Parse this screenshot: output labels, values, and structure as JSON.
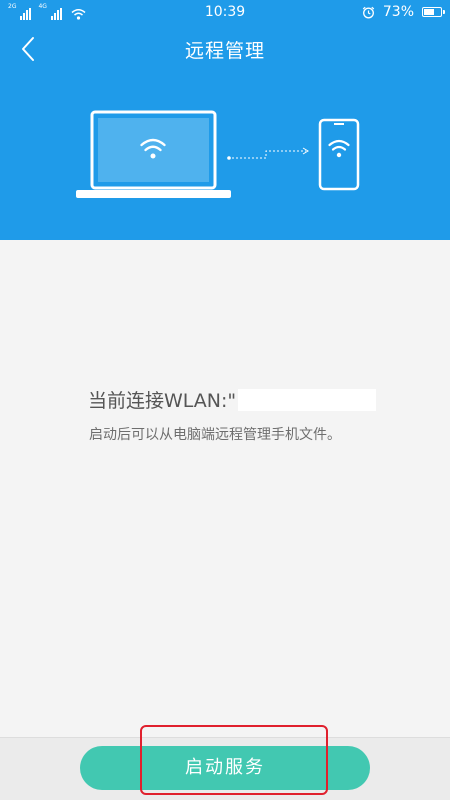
{
  "status_bar": {
    "sim1_label": "2G",
    "sim2_label": "4G",
    "time": "10:39",
    "battery_percent": "73%",
    "battery_level": 0.73
  },
  "header": {
    "title": "远程管理"
  },
  "content": {
    "wlan_label": "当前连接WLAN:\"",
    "hint": "启动后可以从电脑端远程管理手机文件。"
  },
  "action": {
    "start_label": "启动服务"
  },
  "colors": {
    "header_bg": "#1f9be9",
    "button_bg": "#42c8b1",
    "highlight": "#e0202d"
  }
}
